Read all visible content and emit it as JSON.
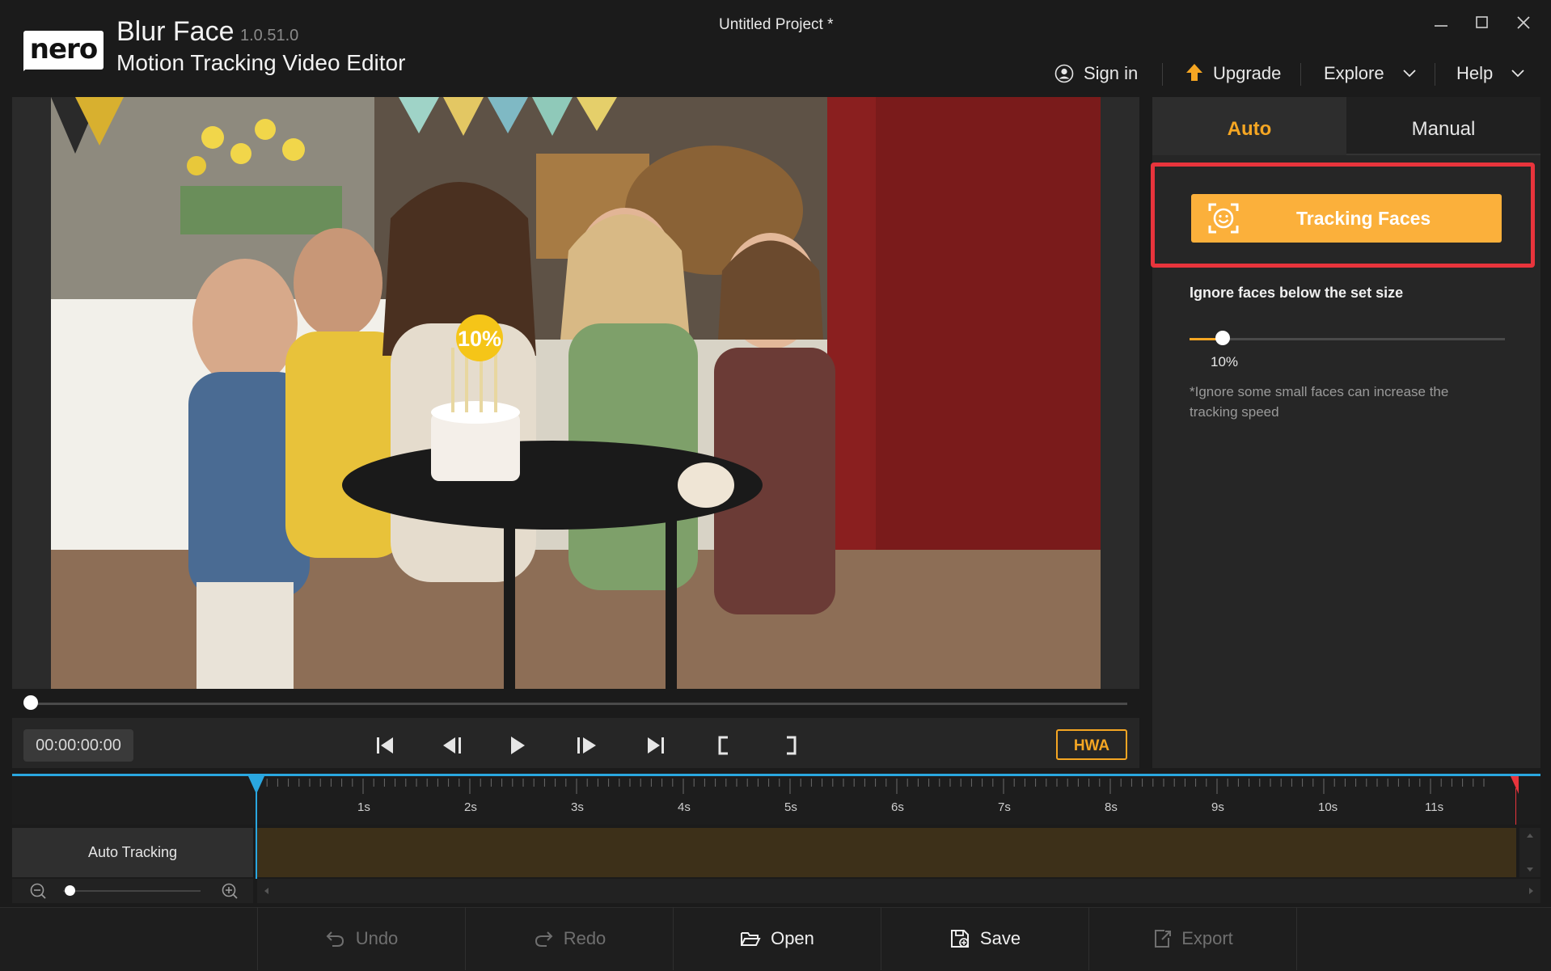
{
  "app": {
    "logo_text": "nero",
    "name": "Blur Face",
    "version": "1.0.51.0",
    "subtitle": "Motion Tracking Video Editor",
    "project_title": "Untitled Project *"
  },
  "window_controls": [
    "minimize-icon",
    "maximize-icon",
    "close-icon"
  ],
  "nav": {
    "signin": "Sign in",
    "upgrade": "Upgrade",
    "explore": "Explore",
    "help": "Help"
  },
  "preview": {
    "overlay_percent": "10%",
    "timecode": "00:00:00:00",
    "hwa_label": "HWA",
    "controls": [
      "skip-to-start-icon",
      "previous-frame-icon",
      "play-icon",
      "next-frame-icon",
      "skip-to-end-icon",
      "mark-in-icon",
      "mark-out-icon"
    ]
  },
  "panel": {
    "tabs": [
      {
        "label": "Auto",
        "active": true
      },
      {
        "label": "Manual",
        "active": false
      }
    ],
    "tracking_button": "Tracking Faces",
    "ignore_title": "Ignore faces below the set size",
    "slider_value": "10%",
    "slider_level": 0.1,
    "ignore_note": "*Ignore some small faces can increase the tracking speed"
  },
  "timeline": {
    "ticks": [
      "1s",
      "2s",
      "3s",
      "4s",
      "5s",
      "6s",
      "7s",
      "8s",
      "9s",
      "10s",
      "11s"
    ],
    "track_label": "Auto Tracking",
    "accent": "#2aa7e0",
    "track_color": "#3d3019"
  },
  "toolbar": {
    "undo": "Undo",
    "redo": "Redo",
    "open": "Open",
    "save": "Save",
    "export": "Export"
  },
  "colors": {
    "brand_orange": "#fbb03b",
    "highlight_red": "#e8343c"
  }
}
